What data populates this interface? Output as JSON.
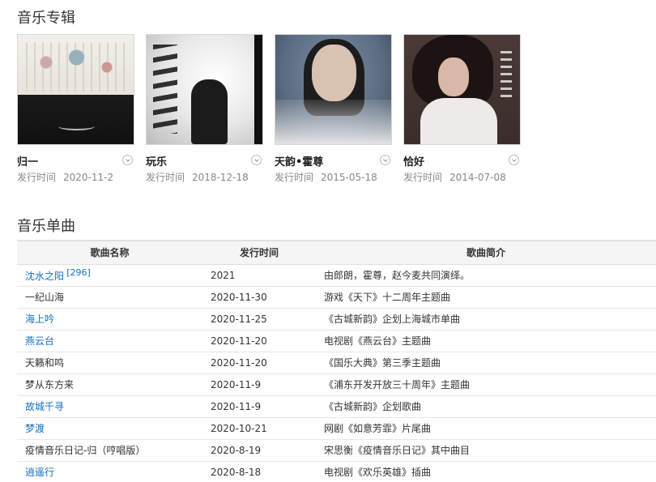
{
  "albums_section": {
    "title": "音乐专辑",
    "date_label": "发行时间",
    "albums": [
      {
        "name": "归一",
        "date": "2020-11-2"
      },
      {
        "name": "玩乐",
        "date": "2018-12-18"
      },
      {
        "name": "天韵•霍尊",
        "date": "2015-05-18"
      },
      {
        "name": "恰好",
        "date": "2014-07-08"
      }
    ]
  },
  "singles_section": {
    "title": "音乐单曲",
    "columns": [
      "歌曲名称",
      "发行时间",
      "歌曲简介"
    ],
    "rows": [
      {
        "name": "沈水之阳",
        "ref": "[296]",
        "date": "2021",
        "desc": "由郎朗，霍尊，赵今麦共同演绎。"
      },
      {
        "name": "一纪山海",
        "date": "2020-11-30",
        "desc": "游戏《天下》十二周年主题曲"
      },
      {
        "name": "海上吟",
        "date": "2020-11-25",
        "desc": "《古城新韵》企划上海城市单曲"
      },
      {
        "name": "燕云台",
        "date": "2020-11-20",
        "desc": "电视剧《燕云台》主题曲"
      },
      {
        "name": "天籁和鸣",
        "date": "2020-11-20",
        "desc": "《国乐大典》第三季主题曲"
      },
      {
        "name": "梦从东方来",
        "date": "2020-11-9",
        "desc": "《浦东开发开放三十周年》主题曲"
      },
      {
        "name": "故城千寻",
        "date": "2020-11-9",
        "desc": "《古城新韵》企划歌曲"
      },
      {
        "name": "梦渡",
        "date": "2020-10-21",
        "desc": "网剧《如意芳霏》片尾曲"
      },
      {
        "name": "疫情音乐日记-归（哼唱版）",
        "date": "2020-8-19",
        "desc": "宋思衡《疫情音乐日记》其中曲目"
      },
      {
        "name": "逍遥行",
        "date": "2020-8-18",
        "desc": "电视剧《欢乐英雄》插曲"
      }
    ]
  },
  "colors": {
    "link": "#136ec2",
    "header_bg": "#f5f5f5",
    "muted": "#888888"
  }
}
